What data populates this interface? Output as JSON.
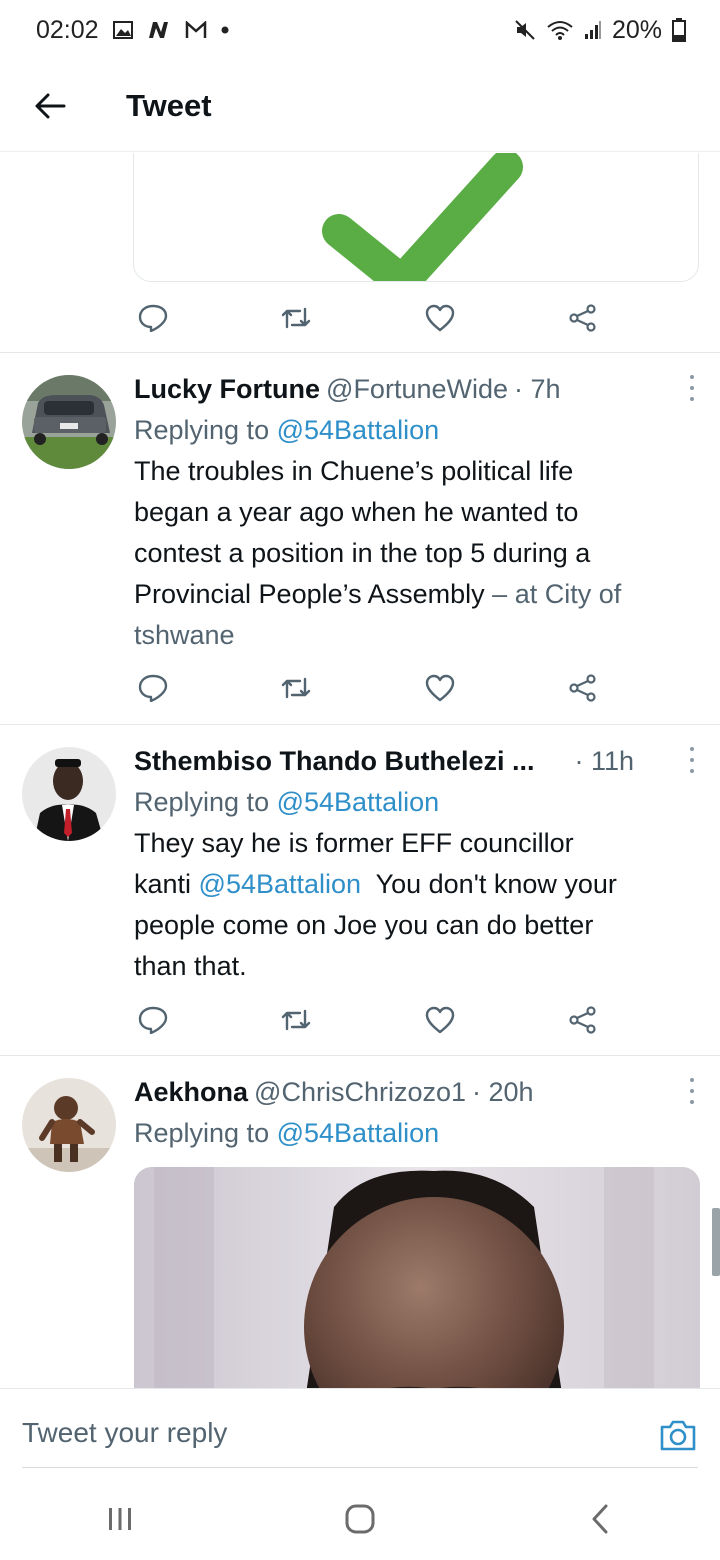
{
  "status_bar": {
    "time": "02:02",
    "notification_icons": [
      "gallery-icon",
      "n-app-icon",
      "gmail-icon",
      "dot-icon"
    ],
    "battery": "20%"
  },
  "header": {
    "title": "Tweet"
  },
  "tweets": [
    {
      "name": "Lucky Fortune",
      "handle": "@FortuneWide",
      "time": "· 7h",
      "replying_prefix": "Replying to",
      "replying_to": "@54Battalion",
      "text_lines": [
        "The troubles in Chuene’s political life",
        "began a year ago when he wanted to",
        "contest a position in the top 5 during a",
        "Provincial People’s Assembly"
      ],
      "text_tail_muted": " – at City of",
      "text_tail_muted2": "tshwane"
    },
    {
      "name": "Sthembiso Thando Buthelezi ...",
      "handle": "",
      "time": "· 11h",
      "replying_prefix": "Replying to",
      "replying_to": "@54Battalion",
      "line1": "They say he is former EFF councillor",
      "line2_prefix": "kanti ",
      "line2_mention": "@54Battalion",
      "line2_suffix": "  You don't know your",
      "line3": "people come on Joe you can do better",
      "line4": "than that."
    },
    {
      "name": "Aekhona",
      "handle": "@ChrisChrizozo1",
      "time": "· 20h",
      "replying_prefix": "Replying to",
      "replying_to": "@54Battalion"
    }
  ],
  "compose": {
    "placeholder": "Tweet your reply"
  },
  "icons": {
    "reply": "reply-icon",
    "retweet": "retweet-icon",
    "like": "heart-icon",
    "share": "share-icon"
  },
  "colors": {
    "accent": "#2f8fc9",
    "muted": "#536471",
    "check": "#5aac45"
  }
}
